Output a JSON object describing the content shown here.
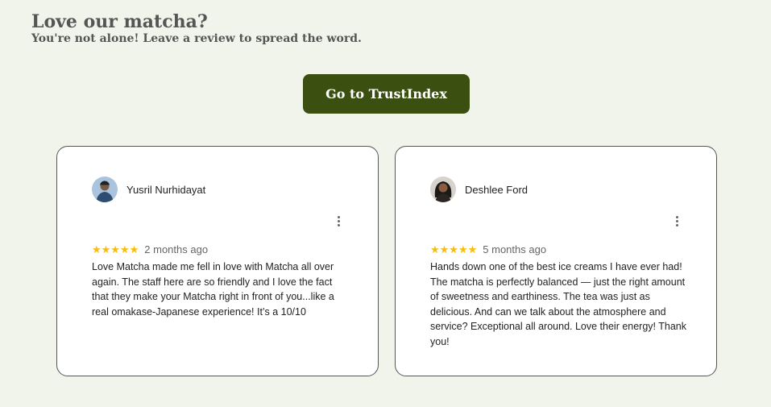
{
  "heading": {
    "title": "Love our matcha?",
    "subtitle": "You're not alone! Leave a review to spread the word."
  },
  "cta": {
    "label": "Go to TrustIndex",
    "bg_color": "#3b5010"
  },
  "colors": {
    "background": "#f1f4ea",
    "star": "#fbbc04"
  },
  "reviews": [
    {
      "name": "Yusril Nurhidayat",
      "stars": "★★★★★",
      "rating": 5,
      "date": "2 months ago",
      "text": "Love Matcha made me fell in love with Matcha all over again. The staff here are so friendly and I love the fact that they make your Matcha right in front of you...like a real omakase-Japanese experience! It’s a 10/10",
      "menu_icon": "more-vert-icon"
    },
    {
      "name": "Deshlee Ford",
      "stars": "★★★★★",
      "rating": 5,
      "date": "5 months ago",
      "text": "Hands down one of the best ice creams I have ever had! The matcha is perfectly balanced — just the right amount of sweetness and earthiness. The tea was just as delicious. And can we talk about the atmosphere and service? Exceptional all around. Love their energy! Thank you!",
      "menu_icon": "more-vert-icon"
    }
  ]
}
